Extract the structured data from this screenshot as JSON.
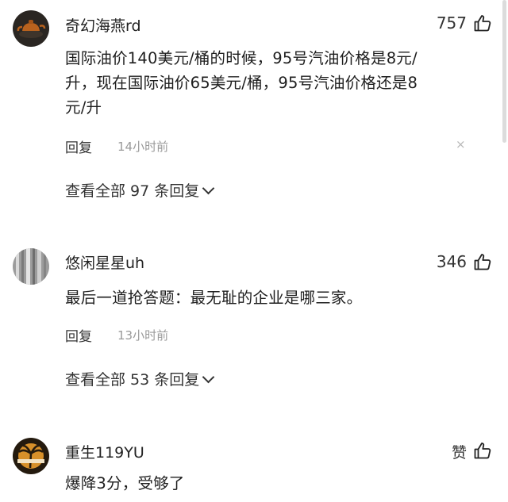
{
  "comments": [
    {
      "username": "奇幻海燕rd",
      "likes": "757",
      "text_lines": [
        "国际油价140美元/桶的时候，95号汽油价格是8元/",
        "升，现在国际油价65美元/桶，95号汽油价格还是8",
        "元/升"
      ],
      "reply_label": "回复",
      "time": "14小时前",
      "dismiss": "×",
      "view_all": "查看全部 97 条回复",
      "avatar_colors": {
        "bg": "#2a2622",
        "accent": "#b8621e"
      }
    },
    {
      "username": "悠闲星星uh",
      "likes": "346",
      "text_lines": [
        "最后一道抢答题：最无耻的企业是哪三家。"
      ],
      "reply_label": "回复",
      "time": "13小时前",
      "view_all": "查看全部 53 条回复",
      "avatar_colors": {
        "bg": "#9c9c9c",
        "accent": "#d9d9d9"
      }
    },
    {
      "username": "重生119YU",
      "likes": "赞",
      "text_lines": [
        "爆降3分，受够了"
      ],
      "avatar_colors": {
        "bg": "#241a0e",
        "accent": "#d7902a"
      }
    }
  ],
  "icons": {
    "like": "thumbs-up-icon",
    "dismiss": "close-icon",
    "expand": "chevron-down-icon"
  }
}
